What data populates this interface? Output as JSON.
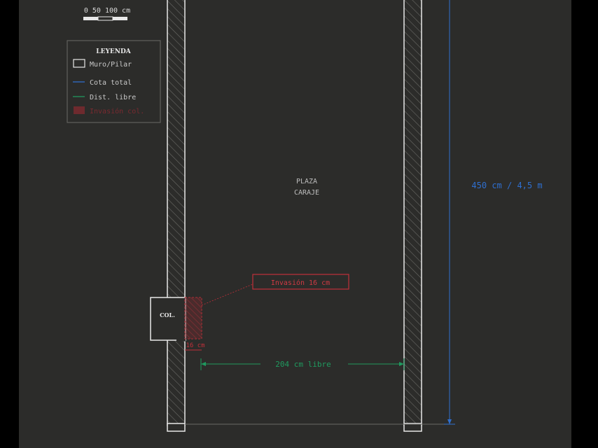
{
  "scale_bar": {
    "label": "0 50 100 cm"
  },
  "legend": {
    "title": "LEYENDA",
    "items": [
      {
        "label": "Muro/Pilar",
        "kind": "box",
        "color": "#e8e8e8"
      },
      {
        "label": "Cota total",
        "kind": "line",
        "color": "#2f6fcf"
      },
      {
        "label": "Dist. libre",
        "kind": "line",
        "color": "#1f9a5f"
      },
      {
        "label": "Invasión col.",
        "kind": "fill",
        "color": "#8a2a30"
      }
    ]
  },
  "space": {
    "line1": "PLAZA",
    "line2": "CARAJE"
  },
  "column": {
    "label": "COL."
  },
  "dimensions": {
    "total": "450 cm / 4,5 m",
    "free": "204 cm libre",
    "invasion_width": "16 cm",
    "invasion_callout": "Invasión 16 cm"
  },
  "colors": {
    "background": "#2c2c2a",
    "outer": "#000000",
    "wall": "#e8e8e8",
    "total": "#2f6fcf",
    "free": "#1f9a5f",
    "invasion": "#c0303a"
  }
}
